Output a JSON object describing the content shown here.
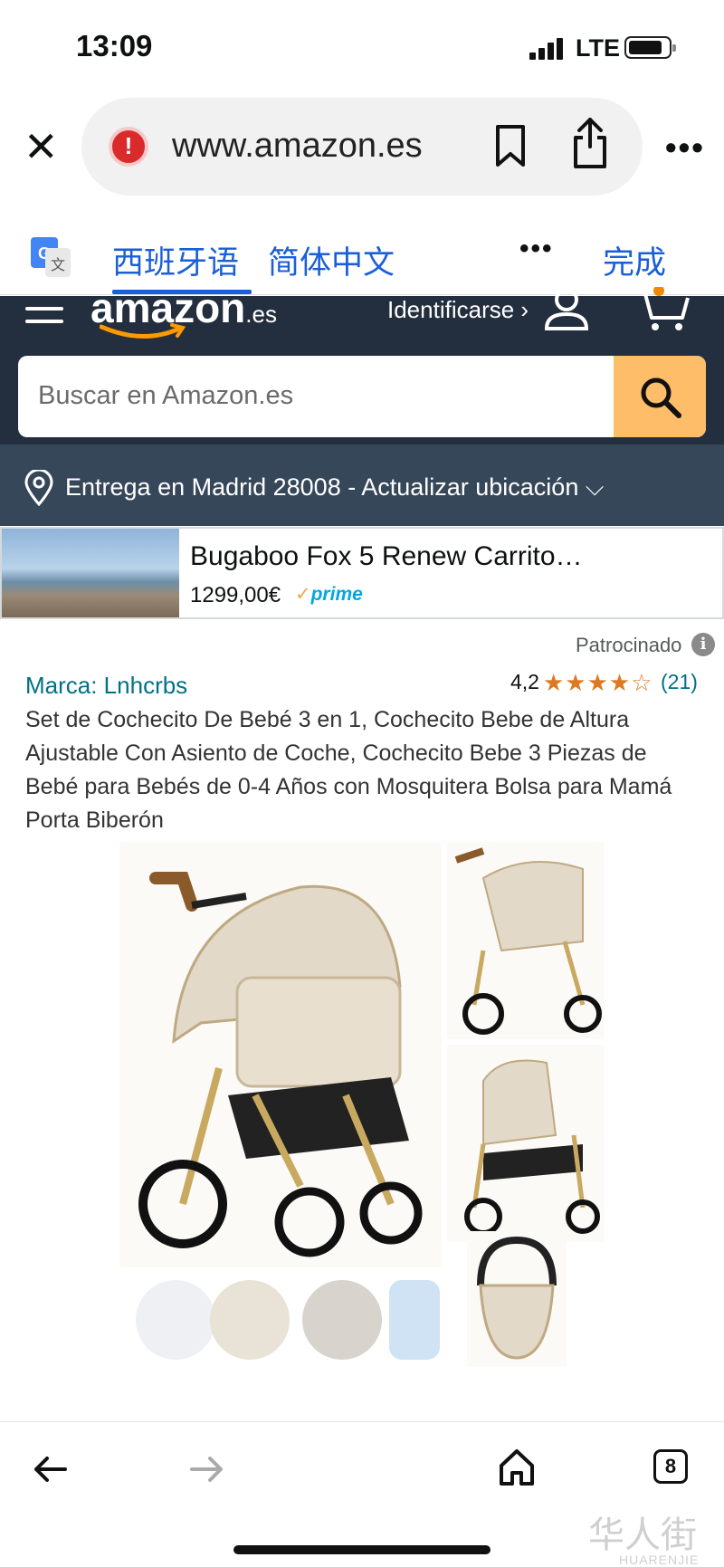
{
  "status_bar": {
    "time": "13:09",
    "network": "LTE"
  },
  "browser": {
    "url": "www.amazon.es"
  },
  "translate_bar": {
    "source_lang": "西班牙语",
    "target_lang": "简体中文",
    "more": "•••",
    "done": "完成"
  },
  "amazon_header": {
    "logo_text": "amazon",
    "logo_suffix": ".es",
    "sign_in": "Identificarse ›",
    "search_placeholder": "Buscar en Amazon.es"
  },
  "delivery": {
    "text": "Entrega en Madrid 28008 - Actualizar ubicación ⌵"
  },
  "sponsored_ad": {
    "title": "Bugaboo Fox 5 Renew Carrito…",
    "price": "1299,00€",
    "prime": "prime"
  },
  "sponsored_label": "Patrocinado",
  "product": {
    "brand": "Marca: Lnhcrbs",
    "rating": "4,2",
    "stars": "★★★★☆",
    "review_count": "(21)",
    "title": "Set de Cochecito De Bebé 3 en 1, Cochecito Bebe de Altura Ajustable Con Asiento de Coche, Cochecito Bebe 3 Piezas de Bebé para Bebés de 0-4 Años con Mosquitera Bolsa para Mamá Porta Biberón"
  },
  "bottom_nav": {
    "tab_count": "8"
  },
  "watermark": {
    "main": "华人街",
    "sub": "HUARENJIE"
  }
}
